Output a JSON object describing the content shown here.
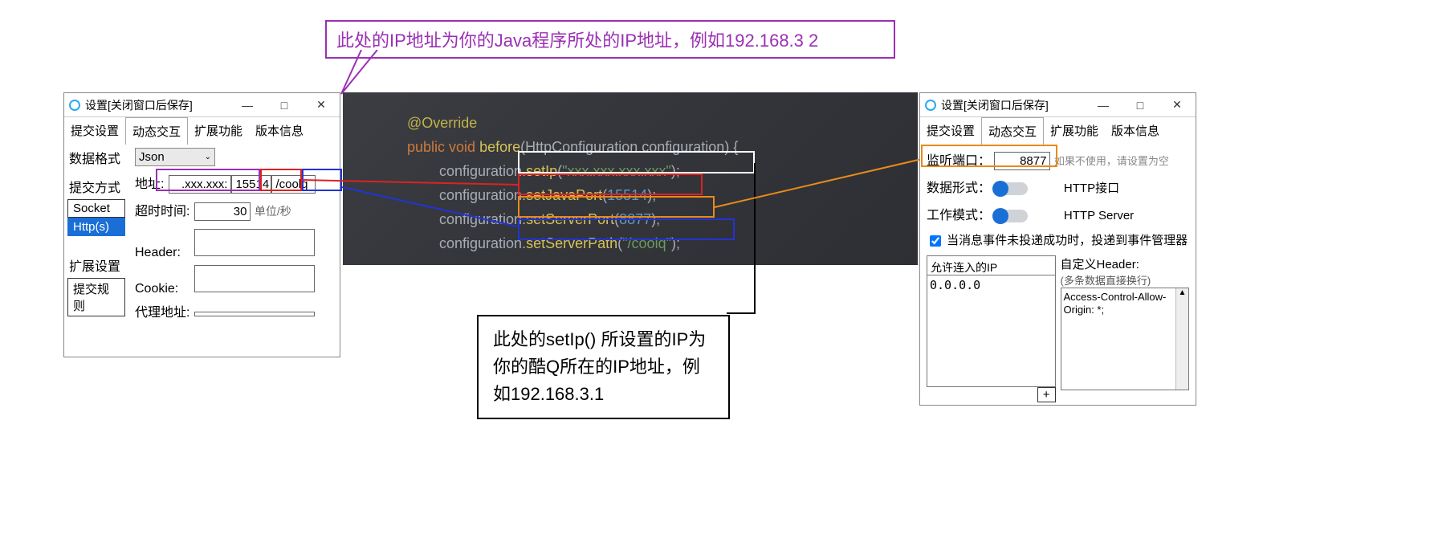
{
  "callout_top": "此处的IP地址为你的Java程序所处的IP地址，例如192.168.3 2",
  "note_setip": "此处的setIp() 所设置的IP为你的酷Q所在的IP地址，例如192.168.3.1",
  "left": {
    "title": "设置[关闭窗口后保存]",
    "tabs": [
      "提交设置",
      "动态交互",
      "扩展功能",
      "版本信息"
    ],
    "active_tab": "动态交互",
    "section_data_format": "数据格式",
    "select_json": "Json",
    "section_submit_method": "提交方式",
    "lbl_address": "地址:",
    "val_ip": ".xxx.xxx:",
    "val_port": "15514",
    "val_path": "/coolq",
    "modes": {
      "socket": "Socket",
      "https": "Http(s)"
    },
    "lbl_timeout": "超时时间:",
    "val_timeout": "30",
    "timeout_unit": "单位/秒",
    "lbl_header": "Header:",
    "lbl_cookie": "Cookie:",
    "lbl_proxy": "代理地址:",
    "section_ext": "扩展设置",
    "btn_submit_rule": "提交规则"
  },
  "code": {
    "ann_override": "@Override",
    "kw_public": "public",
    "kw_void": "void",
    "fn_before": "before",
    "cls_httpconf": "HttpConfiguration",
    "param_conf": "configuration",
    "obj": "configuration",
    "fn_setip": "setIp",
    "arg_ip": "\"xxx.xxx.xxx.xxx\"",
    "fn_setjavaport": "setJavaPort",
    "arg_javaport": "15514",
    "fn_setserverport": "setServerPort",
    "arg_serverport": "8877",
    "fn_setserverpath": "setServerPath",
    "arg_serverpath": "\"/coolq\""
  },
  "right": {
    "title": "设置[关闭窗口后保存]",
    "tabs": [
      "提交设置",
      "动态交互",
      "扩展功能",
      "版本信息"
    ],
    "active_tab": "动态交互",
    "lbl_listen_port": "监听端口：",
    "val_listen_port": "8877",
    "hint_listen": "如果不使用，请设置为空",
    "lbl_data_form": "数据形式：",
    "val_data_form": "HTTP接口",
    "lbl_work_mode": "工作模式：",
    "val_work_mode": "HTTP Server",
    "chk_label": "当消息事件未投递成功时，投递到事件管理器",
    "panel_allow_ip_title": "允许连入的IP",
    "panel_allow_ip_val": "0.0.0.0",
    "panel_header_title": "自定义Header:",
    "panel_header_sub": "(多条数据直接换行)",
    "panel_header_val": "Access-Control-Allow-Origin: *;",
    "btn_plus": "+"
  }
}
